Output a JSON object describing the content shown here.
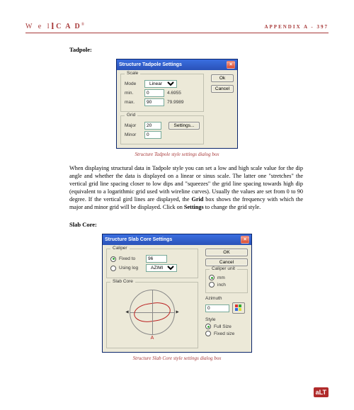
{
  "header": {
    "brand_prefix": "W e l",
    "brand_bar": "l",
    "brand_suffix": "C A D",
    "brand_reg": "®",
    "appendix": "APPENDIX A - 397"
  },
  "tadpole": {
    "section_label": "Tadpole:",
    "dialog_title": "Structure Tadpole Settings",
    "scale_legend": "Scale",
    "mode_label": "Mode",
    "mode_value": "Linear",
    "min_label": "min.",
    "min_value": "0",
    "min_angle": "4.6955",
    "max_label": "max.",
    "max_value": "90",
    "max_angle": "79.9989",
    "grid_legend": "Grid",
    "major_label": "Major",
    "major_value": "20",
    "settings_btn": "Settings...",
    "minor_label": "Minor",
    "minor_value": "0",
    "ok": "Ok",
    "cancel": "Cancel",
    "caption": "Structure Tadpole style settings dialog box"
  },
  "para1": "When displaying structural data in Tadpole style you can set a low and high scale value for the dip angle and whether the data is displayed on a linear or sinus scale. The latter one \"stretches\" the vertical grid line spacing closer to low dips and \"squeezes\" the grid line spacing towards high dip (equivalent to a logarithmic grid used with wireline curves). Usually the values are set from 0 to 90 degree. If the vertical gird lines are displayed, the Grid box shows the frequency with which the major and minor grid will be displayed. Click on Settings to change the grid style.",
  "slab": {
    "section_label": "Slab Core:",
    "dialog_title": "Structure Slab Core Settings",
    "caliper_legend": "Caliper",
    "fixed_label": "Fixed to",
    "fixed_value": "96",
    "using_label": "Using log",
    "using_value": "AZIMI",
    "unit_legend": "Caliper unit",
    "unit_mm": "mm",
    "unit_inch": "inch",
    "slabcore_legend": "Slab Core",
    "azimuth_label": "Azimuth",
    "azimuth_value": "0",
    "style_label": "Style",
    "style_full": "Full Size",
    "style_fixed": "Fixed size",
    "a_label": "A",
    "ok": "OK",
    "cancel": "Cancel",
    "caption": "Structure Slab Core style settings dialog box"
  },
  "footer_logo": "aLT"
}
